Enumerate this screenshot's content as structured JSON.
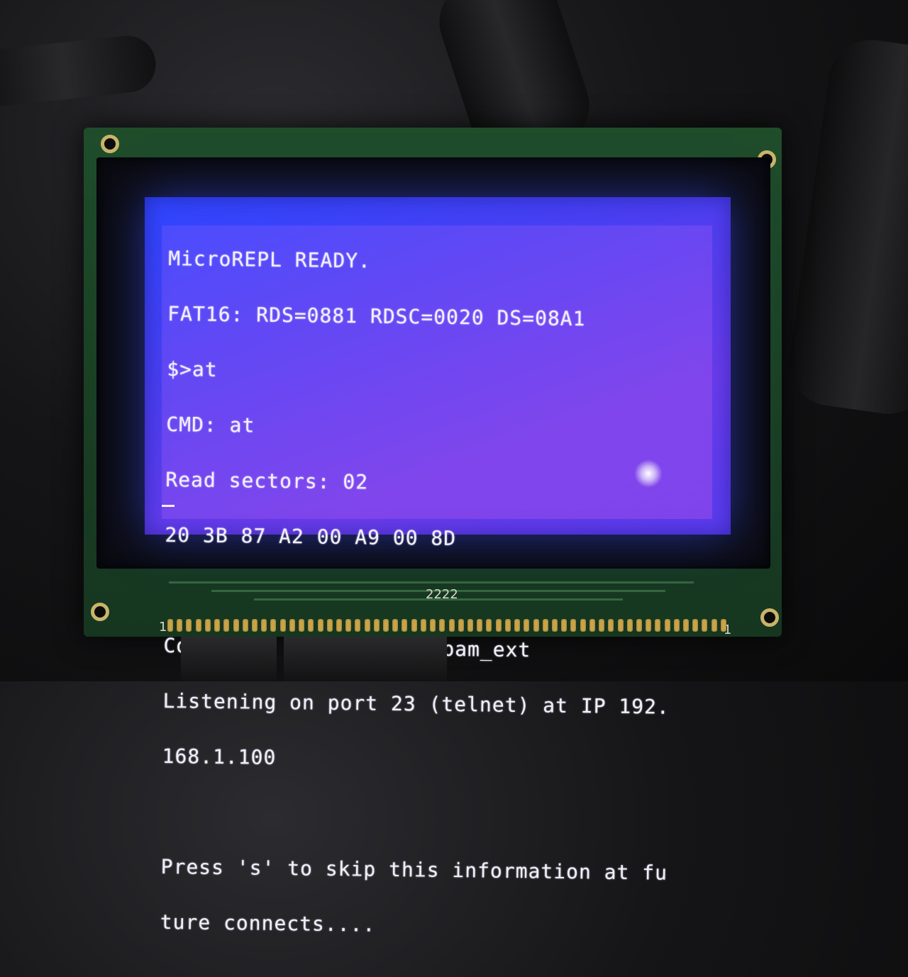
{
  "screen": {
    "lines": [
      "MicroREPL READY.",
      "FAT16: RDS=0881 RDSC=0020 DS=08A1",
      "$>at",
      "CMD: at",
      "Read sectors: 02",
      "20 3B 87 A2 00 A9 00 8D",
      "",
      "Connected to network Spam_ext",
      "Listening on port 23 (telnet) at IP 192.",
      "168.1.100",
      "",
      "Press 's' to skip this information at fu",
      "ture connects...."
    ]
  },
  "pcb": {
    "label": "2222",
    "pin_left": "1",
    "pin_right": "1"
  },
  "colors": {
    "lcd_backlight": "#4a3ff2",
    "lcd_text": "#f2eefe",
    "pcb_green": "#1f4d2a"
  }
}
